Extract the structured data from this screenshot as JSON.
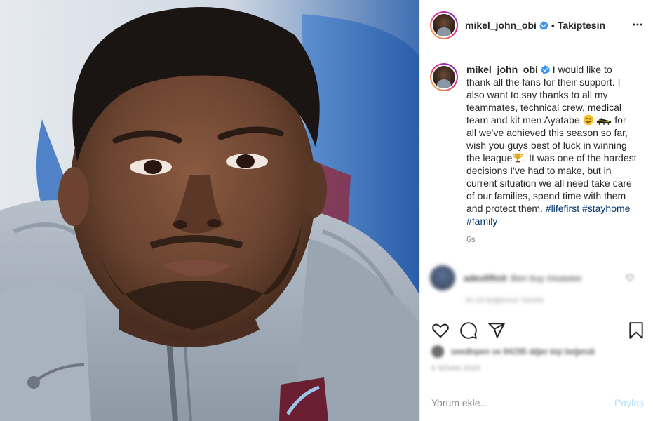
{
  "post": {
    "username": "mikel_john_obi",
    "follow_state": "Takiptesin",
    "separator": "•",
    "caption_part1": " I would like to thank all the fans for their support. I also want to say thanks to all my teammates, technical crew, medical team and kit men Ayatabe ",
    "caption_part2": " for all we've achieved this season so far, wish you guys best of luck in winning the league",
    "caption_part3": ". It was one of the hardest decisions I've had to make, but in current situation we all need take care of our families, spend time with them and protect them. ",
    "hashtags": [
      "#lifefirst",
      "#stayhome",
      "#family"
    ],
    "time_ago": "6s"
  },
  "comment": {
    "user": "adesfifinit",
    "text": "Ben buy moawee",
    "meta": "4s   19 beğenme   Yanıtla"
  },
  "likes": {
    "text": "seedlopen ve 84295 diğer kişi beğendi"
  },
  "date": "6 NİSAN 2020",
  "comment_box": {
    "placeholder": "Yorum ekle...",
    "post_label": "Paylaş"
  },
  "icons": {
    "verified": "verified-badge-icon",
    "more": "more-options-icon",
    "like": "heart-icon",
    "comment": "comment-icon",
    "share": "paper-plane-icon",
    "save": "bookmark-icon"
  },
  "colors": {
    "hashtag": "#00376b",
    "verified": "#3897f0",
    "post_button_disabled": "#b2dffc",
    "secondary_text": "#8e8e8e"
  }
}
